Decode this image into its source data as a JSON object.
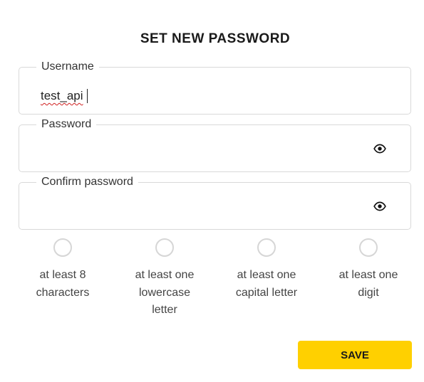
{
  "form": {
    "title": "SET NEW PASSWORD",
    "username": {
      "label": "Username",
      "value": "test_api"
    },
    "password": {
      "label": "Password",
      "value": "",
      "toggle_icon": "eye-icon"
    },
    "confirm_password": {
      "label": "Confirm password",
      "value": "",
      "toggle_icon": "eye-icon"
    },
    "requirements": [
      {
        "text": "at least 8 characters",
        "met": false
      },
      {
        "text": "at least one lowercase letter",
        "met": false
      },
      {
        "text": "at least one capital letter",
        "met": false
      },
      {
        "text": "at least one digit",
        "met": false
      }
    ],
    "save_label": "SAVE",
    "accent_color": "#ffd000"
  }
}
